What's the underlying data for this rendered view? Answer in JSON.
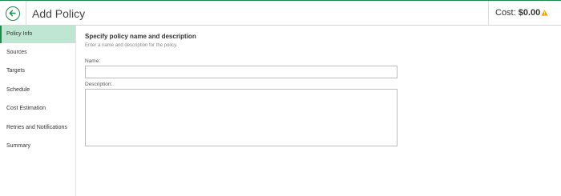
{
  "header": {
    "title": "Add Policy",
    "cost_label": "Cost:",
    "cost_value": "$0.00",
    "back_icon": "arrow-left-circle-icon",
    "warning_icon": "warning-triangle-icon"
  },
  "sidebar": {
    "items": [
      {
        "label": "Policy Info",
        "active": true
      },
      {
        "label": "Sources",
        "active": false
      },
      {
        "label": "Targets",
        "active": false
      },
      {
        "label": "Schedule",
        "active": false
      },
      {
        "label": "Cost Estimation",
        "active": false
      },
      {
        "label": "Retries and Notifications",
        "active": false
      },
      {
        "label": "Summary",
        "active": false
      }
    ]
  },
  "main": {
    "section_title": "Specify policy name and description",
    "section_desc": "Enter a name and description for the policy.",
    "name_label": "Name:",
    "name_value": "",
    "description_label": "Description:",
    "description_value": ""
  },
  "colors": {
    "accent": "#1a8a4a",
    "active_bg": "#bfe6d3",
    "warning": "#e8a317"
  }
}
